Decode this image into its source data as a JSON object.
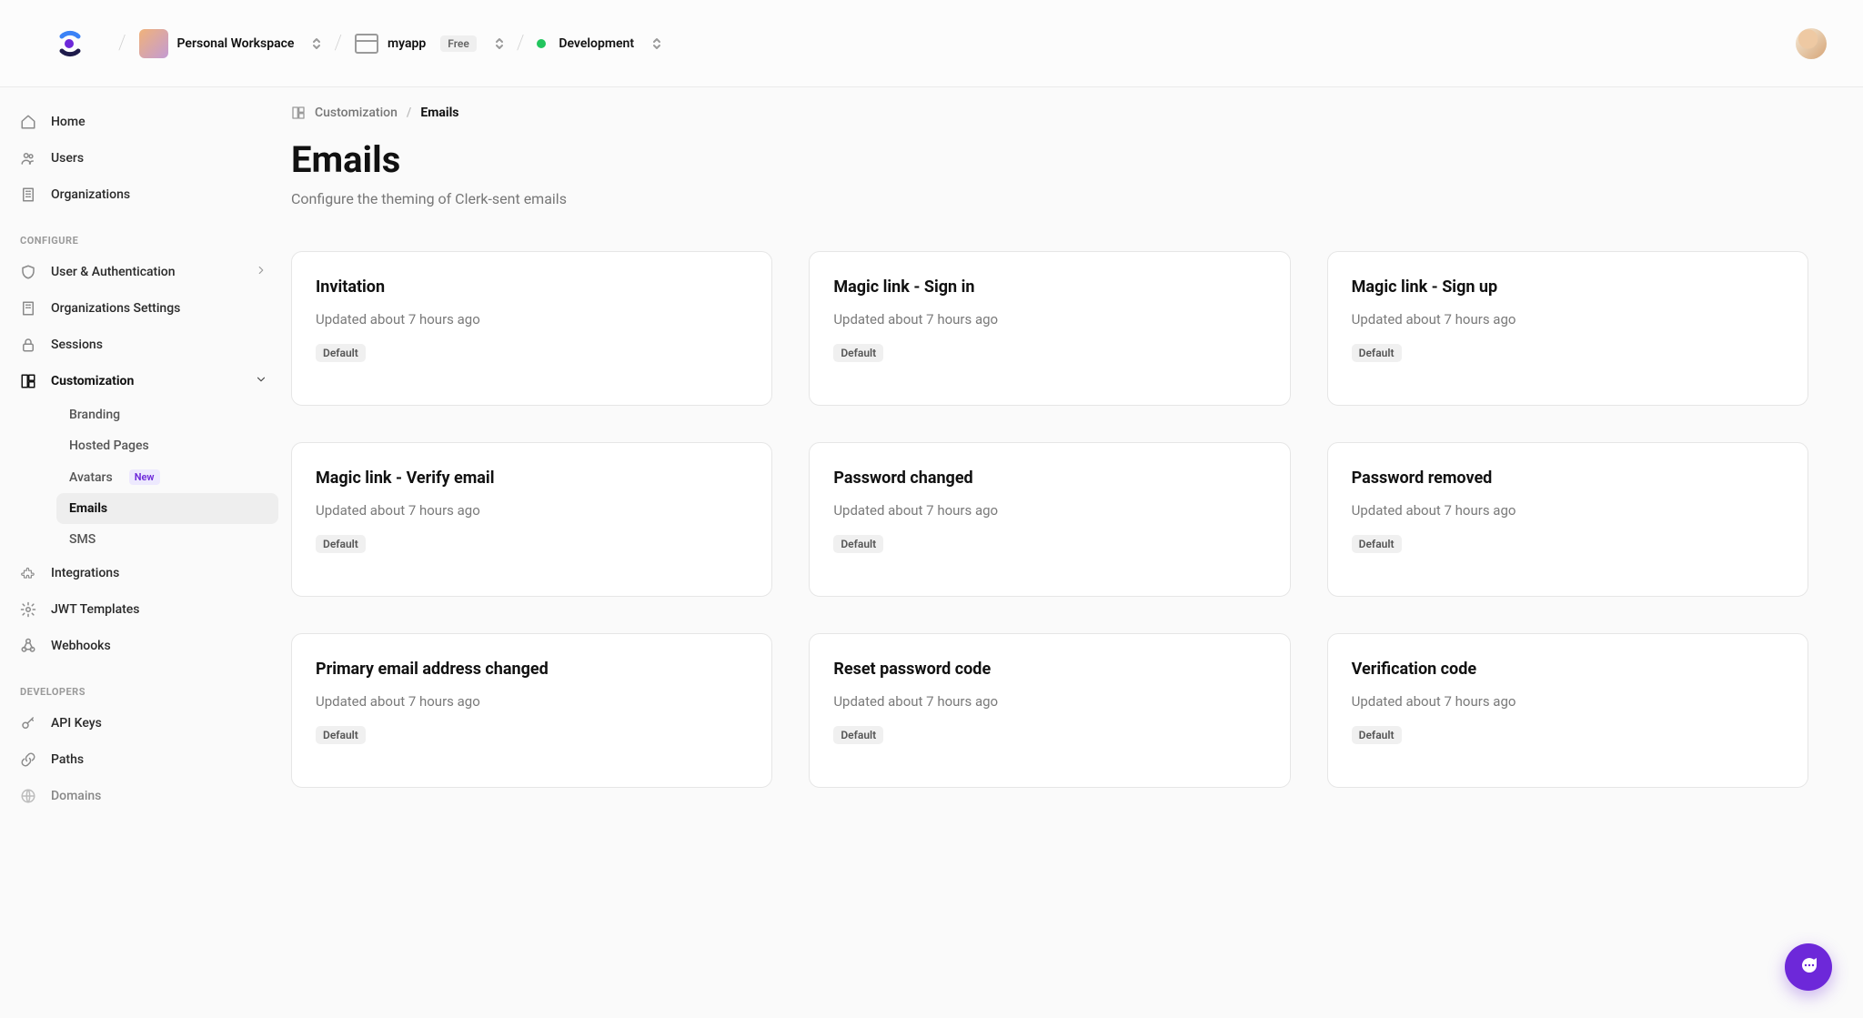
{
  "header": {
    "workspace": "Personal Workspace",
    "app": "myapp",
    "app_plan": "Free",
    "env": "Development"
  },
  "sidebar": {
    "nav_top": [
      {
        "label": "Home"
      },
      {
        "label": "Users"
      },
      {
        "label": "Organizations"
      }
    ],
    "section_configure": "CONFIGURE",
    "nav_configure": [
      {
        "label": "User & Authentication",
        "caret": "right"
      },
      {
        "label": "Organizations Settings"
      },
      {
        "label": "Sessions"
      },
      {
        "label": "Customization",
        "caret": "down",
        "active": true
      }
    ],
    "customization_sub": [
      {
        "label": "Branding"
      },
      {
        "label": "Hosted Pages"
      },
      {
        "label": "Avatars",
        "new": "New"
      },
      {
        "label": "Emails",
        "selected": true
      },
      {
        "label": "SMS"
      }
    ],
    "nav_configure_after": [
      {
        "label": "Integrations"
      },
      {
        "label": "JWT Templates"
      },
      {
        "label": "Webhooks"
      }
    ],
    "section_developers": "DEVELOPERS",
    "nav_developers": [
      {
        "label": "API Keys"
      },
      {
        "label": "Paths"
      },
      {
        "label": "Domains"
      }
    ]
  },
  "breadcrumb": {
    "root": "Customization",
    "current": "Emails"
  },
  "page": {
    "title": "Emails",
    "subtitle": "Configure the theming of Clerk-sent emails"
  },
  "badge_default": "Default",
  "updated_text": "Updated about 7 hours ago",
  "cards": [
    {
      "title": "Invitation"
    },
    {
      "title": "Magic link - Sign in"
    },
    {
      "title": "Magic link - Sign up"
    },
    {
      "title": "Magic link - Verify email"
    },
    {
      "title": "Password changed"
    },
    {
      "title": "Password removed"
    },
    {
      "title": "Primary email address changed"
    },
    {
      "title": "Reset password code"
    },
    {
      "title": "Verification code"
    }
  ]
}
